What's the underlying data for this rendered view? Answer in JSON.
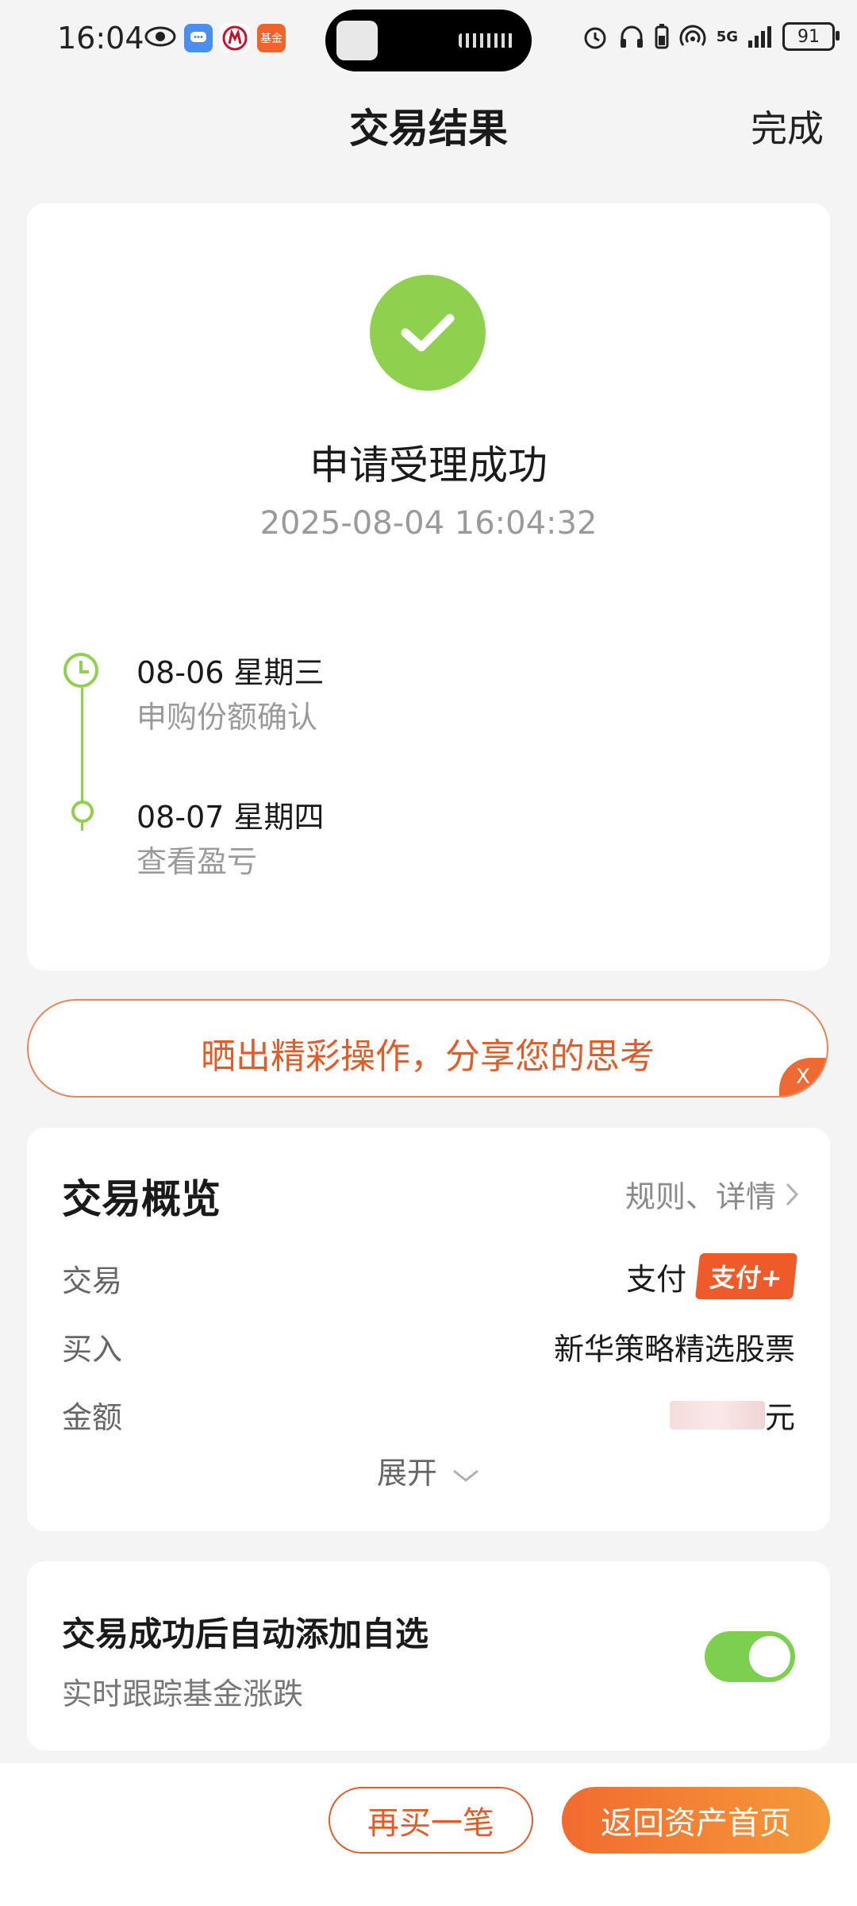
{
  "status_bar": {
    "time": "16:04",
    "battery": "91",
    "network": "5G",
    "left_icons": [
      "eye-icon",
      "message-icon",
      "bank-icon",
      "fund-app-icon"
    ],
    "fund_app_label": "基金"
  },
  "header": {
    "title": "交易结果",
    "done_label": "完成"
  },
  "result": {
    "title": "申请受理成功",
    "timestamp": "2025-08-04 16:04:32",
    "timeline": [
      {
        "date": "08-06  星期三",
        "desc": "申购份额确认"
      },
      {
        "date": "08-07  星期四",
        "desc": "查看盈亏"
      }
    ]
  },
  "share_banner": {
    "text": "晒出精彩操作，分享您的思考",
    "close_label": "X"
  },
  "overview": {
    "title": "交易概览",
    "link_label": "规则、详情",
    "rows": [
      {
        "label": "交易",
        "value": "支付",
        "badge": "支付+"
      },
      {
        "label": "买入",
        "value": "新华策略精选股票"
      },
      {
        "label": "金额",
        "value": "元"
      }
    ],
    "expand_label": "展开"
  },
  "watchlist": {
    "title": "交易成功后自动添加自选",
    "subtitle": "实时跟踪基金涨跌",
    "toggle_on": true
  },
  "actions": {
    "buy_again": "再买一笔",
    "back_home": "返回资产首页"
  },
  "colors": {
    "accent": "#ef6a32",
    "success": "#8fd14f",
    "toggle": "#7dcf4f"
  }
}
